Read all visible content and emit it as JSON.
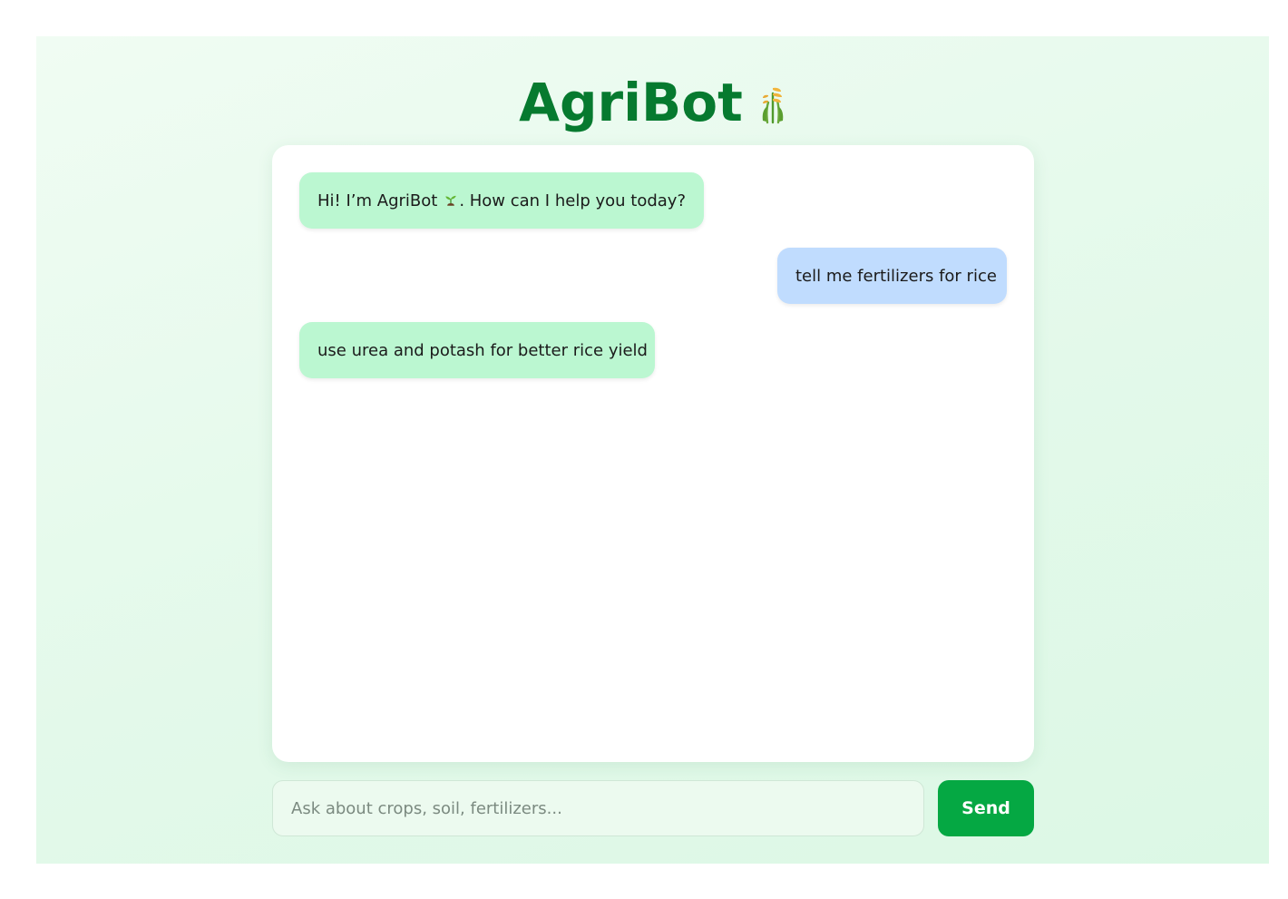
{
  "header": {
    "title": "AgriBot",
    "title_icon": "sheaf-of-rice-icon"
  },
  "chat": {
    "messages": [
      {
        "sender": "bot",
        "text_before_icon": "Hi! I’m AgriBot",
        "icon": "seedling-icon",
        "text_after_icon": ". How can I help you today?"
      },
      {
        "sender": "user",
        "text": "tell me fertilizers for rice"
      },
      {
        "sender": "bot",
        "text": "use urea and potash for better rice yield"
      }
    ]
  },
  "composer": {
    "placeholder": "Ask about crops, soil, fertilizers...",
    "value": "",
    "send_label": "Send"
  },
  "colors": {
    "brand": "#067a2f",
    "bot_bubble": "#bbf7d1",
    "user_bubble": "#c0dcfe",
    "send_button": "#05a843"
  }
}
